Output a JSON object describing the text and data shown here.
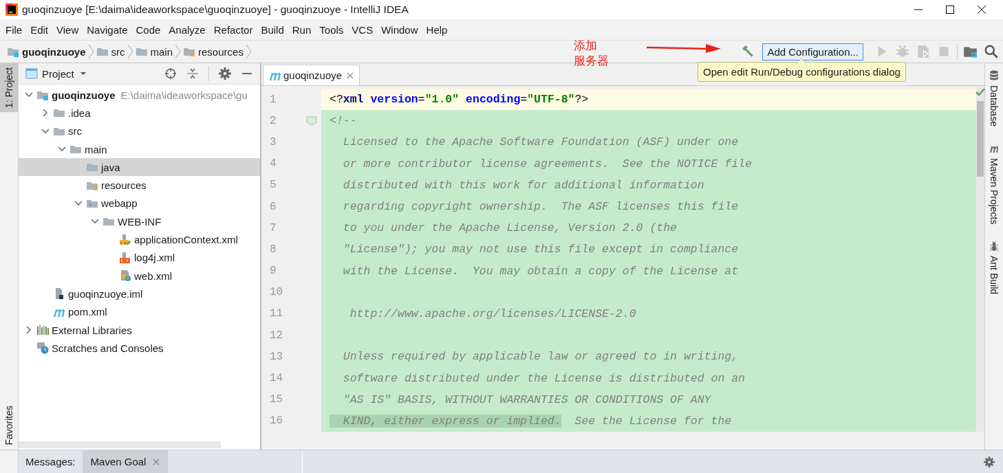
{
  "window": {
    "title": "guoqinzuoye [E:\\daima\\ideaworkspace\\guoqinzuoye] - guoqinzuoye - IntelliJ IDEA"
  },
  "menu": [
    "File",
    "Edit",
    "View",
    "Navigate",
    "Code",
    "Analyze",
    "Refactor",
    "Build",
    "Run",
    "Tools",
    "VCS",
    "Window",
    "Help"
  ],
  "breadcrumbs": [
    {
      "label": "guoqinzuoye",
      "kind": "module"
    },
    {
      "label": "src",
      "kind": "folder"
    },
    {
      "label": "main",
      "kind": "folder"
    },
    {
      "label": "resources",
      "kind": "resources"
    }
  ],
  "annotation": {
    "lines": [
      "添加",
      "服务器"
    ]
  },
  "toolbar": {
    "buttons": [
      {
        "kind": "build",
        "disabled": false
      },
      {
        "kind": "config",
        "label": "Add Configuration...",
        "disabled": false
      },
      {
        "kind": "run",
        "disabled": true
      },
      {
        "kind": "debug",
        "disabled": true
      },
      {
        "kind": "coverage",
        "disabled": true
      },
      {
        "kind": "stop",
        "disabled": true
      },
      {
        "kind": "structure",
        "disabled": false
      },
      {
        "kind": "search",
        "disabled": false
      }
    ],
    "tooltip": "Open edit Run/Debug configurations dialog"
  },
  "left_stripe": [
    {
      "label": "1: Project",
      "selected": true
    },
    {
      "label": "Favorites",
      "selected": false
    }
  ],
  "project_panel": {
    "title": "Project",
    "tree": [
      {
        "label": "guoqinzuoye",
        "hint": "E:\\daima\\ideaworkspace\\gu",
        "kind": "module",
        "expanded": true,
        "selected": false,
        "children": [
          {
            "label": ".idea",
            "kind": "folder",
            "expanded": false,
            "selected": false
          },
          {
            "label": "src",
            "kind": "folder",
            "expanded": true,
            "selected": false,
            "children": [
              {
                "label": "main",
                "kind": "folder",
                "expanded": true,
                "selected": false,
                "children": [
                  {
                    "label": "java",
                    "kind": "folder",
                    "selected": true
                  },
                  {
                    "label": "resources",
                    "kind": "resources",
                    "selected": false
                  },
                  {
                    "label": "webapp",
                    "kind": "web",
                    "expanded": true,
                    "selected": false,
                    "children": [
                      {
                        "label": "WEB-INF",
                        "kind": "folder",
                        "expanded": true,
                        "selected": false,
                        "children": [
                          {
                            "label": "applicationContext.xml",
                            "kind": "spring-xml",
                            "selected": false
                          },
                          {
                            "label": "log4j.xml",
                            "kind": "xml",
                            "selected": false
                          },
                          {
                            "label": "web.xml",
                            "kind": "web-xml",
                            "selected": false
                          }
                        ]
                      }
                    ]
                  }
                ]
              }
            ]
          },
          {
            "label": "guoqinzuoye.iml",
            "kind": "iml",
            "selected": false
          },
          {
            "label": "pom.xml",
            "kind": "maven",
            "selected": false
          }
        ]
      },
      {
        "label": "External Libraries",
        "kind": "libraries",
        "expanded": false,
        "selected": false
      },
      {
        "label": "Scratches and Consoles",
        "kind": "scratches",
        "selected": false
      }
    ]
  },
  "editor": {
    "tabs": [
      {
        "label": "guoqinzuoye",
        "selected": true
      }
    ],
    "lines": [
      {
        "number": "1",
        "current": true,
        "segments": [
          {
            "text": "<?",
            "kind": "punct"
          },
          {
            "text": "xml",
            "kind": "tag"
          },
          {
            "text": " version",
            "kind": "attr"
          },
          {
            "text": "=",
            "kind": "punct"
          },
          {
            "text": "\"1.0\"",
            "kind": "value"
          },
          {
            "text": " encoding",
            "kind": "attr"
          },
          {
            "text": "=",
            "kind": "punct"
          },
          {
            "text": "\"UTF-8\"",
            "kind": "value"
          },
          {
            "text": "?>",
            "kind": "punct"
          }
        ]
      },
      {
        "number": "2",
        "current": false,
        "fold": true,
        "segments": [
          {
            "text": "<!--",
            "kind": "comment"
          }
        ]
      },
      {
        "number": "3",
        "current": false,
        "segments": [
          {
            "text": "  Licensed to the Apache Software Foundation (ASF) under one",
            "kind": "comment"
          }
        ]
      },
      {
        "number": "4",
        "current": false,
        "segments": [
          {
            "text": "  or more contributor license agreements.  See the NOTICE file",
            "kind": "comment"
          }
        ]
      },
      {
        "number": "5",
        "current": false,
        "segments": [
          {
            "text": "  distributed with this work for additional information",
            "kind": "comment"
          }
        ]
      },
      {
        "number": "6",
        "current": false,
        "segments": [
          {
            "text": "  regarding copyright ownership.  The ASF licenses this file",
            "kind": "comment"
          }
        ]
      },
      {
        "number": "7",
        "current": false,
        "segments": [
          {
            "text": "  to you under the Apache License, Version 2.0 (the",
            "kind": "comment"
          }
        ]
      },
      {
        "number": "8",
        "current": false,
        "segments": [
          {
            "text": "  \"License\"); you may not use this file except in compliance",
            "kind": "comment"
          }
        ]
      },
      {
        "number": "9",
        "current": false,
        "segments": [
          {
            "text": "  with the License.  You may obtain a copy of the License at",
            "kind": "comment"
          }
        ]
      },
      {
        "number": "10",
        "current": false
      },
      {
        "number": "11",
        "current": false,
        "segments": [
          {
            "text": "   http://www.apache.org/licenses/LICENSE-2.0",
            "kind": "comment"
          }
        ]
      },
      {
        "number": "12",
        "current": false
      },
      {
        "number": "13",
        "current": false,
        "segments": [
          {
            "text": "  Unless required by applicable law or agreed to in writing,",
            "kind": "comment"
          }
        ]
      },
      {
        "number": "14",
        "current": false,
        "segments": [
          {
            "text": "  software distributed under the License is distributed on an",
            "kind": "comment"
          }
        ]
      },
      {
        "number": "15",
        "current": false,
        "segments": [
          {
            "text": "  \"AS IS\" BASIS, WITHOUT WARRANTIES OR CONDITIONS OF ANY",
            "kind": "comment"
          }
        ]
      },
      {
        "number": "16",
        "current": false,
        "segments": [
          {
            "text": "  KIND, either express or implied.",
            "kind": "comment-hl"
          },
          {
            "text": "  See the License for the",
            "kind": "comment"
          }
        ]
      }
    ]
  },
  "right_stripe": [
    {
      "label": "Database",
      "kind": "database"
    },
    {
      "label": "Maven Projects",
      "kind": "maven"
    },
    {
      "label": "Ant Build",
      "kind": "ant"
    }
  ],
  "bottom_bar": {
    "label": "Messages:",
    "tabs": [
      {
        "label": "Maven Goal",
        "selected": true
      }
    ]
  }
}
